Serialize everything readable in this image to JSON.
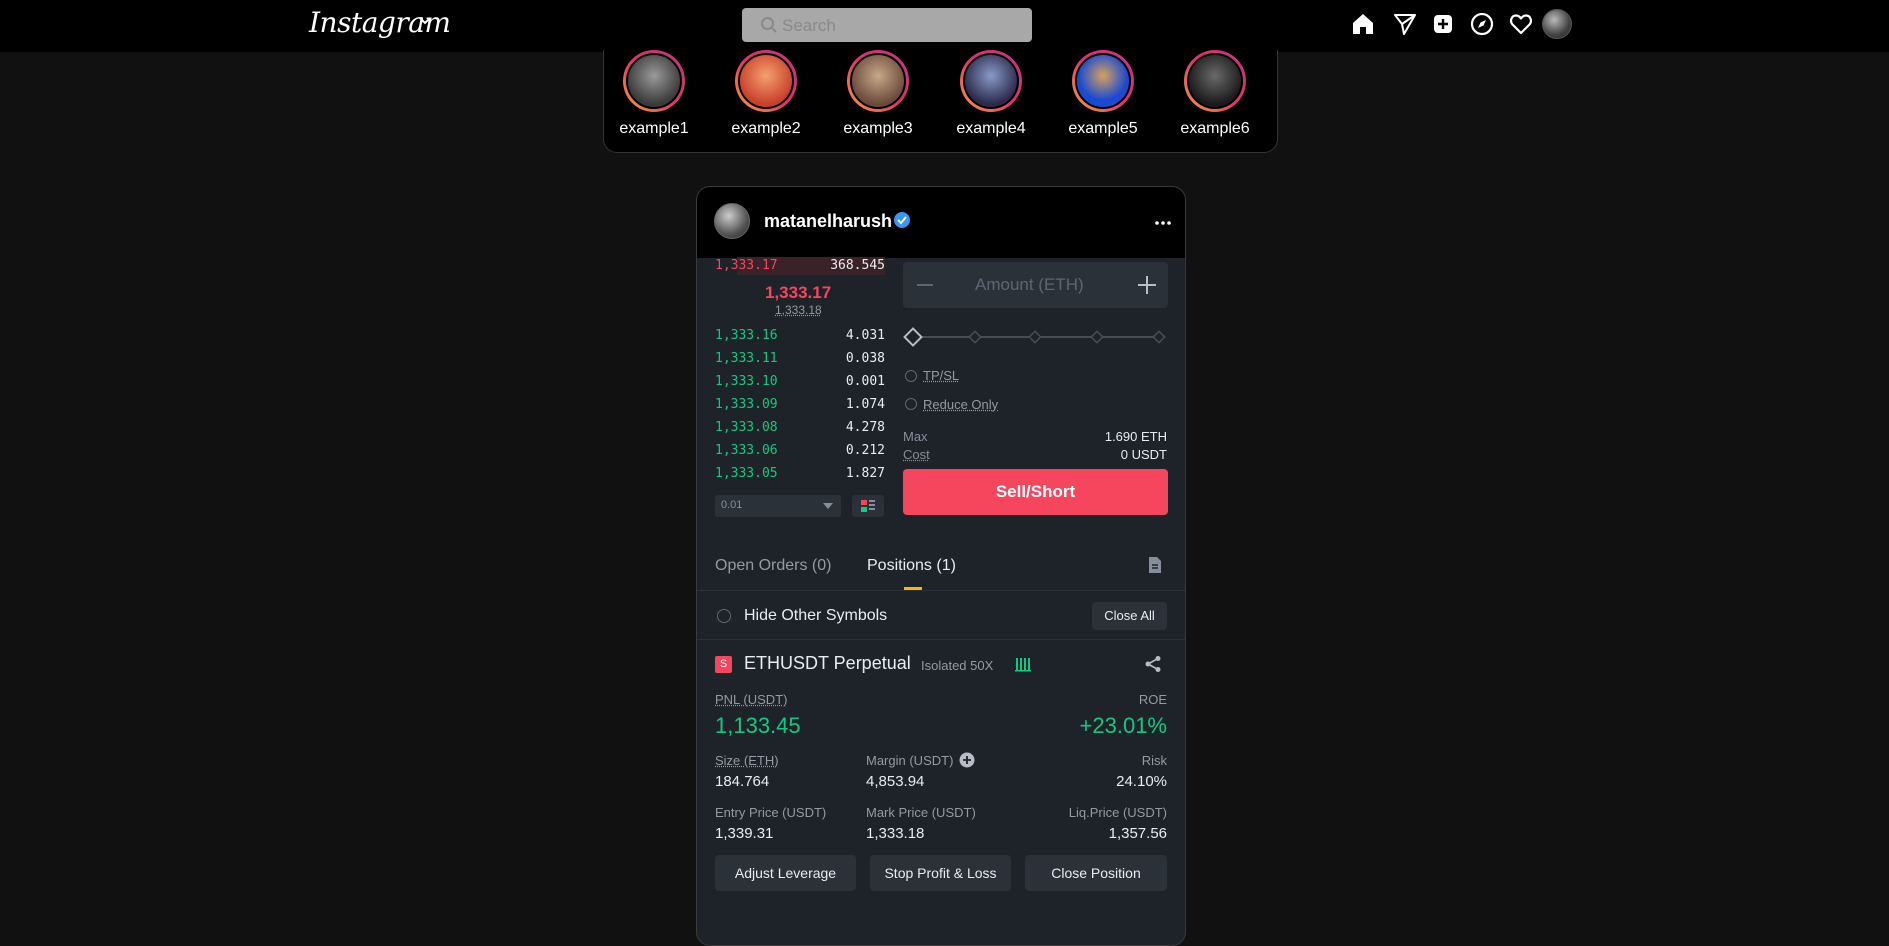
{
  "topnav": {
    "logo": "Instagram",
    "search_placeholder": "Search"
  },
  "stories": [
    {
      "name": "example1",
      "color": "#6b6b6b"
    },
    {
      "name": "example2",
      "color": "#e8603a"
    },
    {
      "name": "example3",
      "color": "#9a7a5a"
    },
    {
      "name": "example4",
      "color": "#3a4a7a"
    },
    {
      "name": "example5",
      "color": "#2a5ad0"
    },
    {
      "name": "example6",
      "color": "#3a3a3a"
    }
  ],
  "post": {
    "username": "matanelharush",
    "orderbook": {
      "ask": {
        "price": "1,333.17",
        "qty": "368.545"
      },
      "mid_price": "1,333.17",
      "mark_price": "1,333.18",
      "bids": [
        {
          "price": "1,333.16",
          "qty": "4.031"
        },
        {
          "price": "1,333.11",
          "qty": "0.038"
        },
        {
          "price": "1,333.10",
          "qty": "0.001"
        },
        {
          "price": "1,333.09",
          "qty": "1.074"
        },
        {
          "price": "1,333.08",
          "qty": "4.278"
        },
        {
          "price": "1,333.06",
          "qty": "0.212"
        },
        {
          "price": "1,333.05",
          "qty": "1.827"
        }
      ],
      "tick_select": "0.01"
    },
    "form": {
      "amount_placeholder": "Amount (ETH)",
      "tpsl_label": "TP/SL",
      "reduce_only_label": "Reduce Only",
      "max_label": "Max",
      "max_value": "1.690 ETH",
      "cost_label": "Cost",
      "cost_value": "0 USDT",
      "sell_button": "Sell/Short"
    },
    "tabs": {
      "open_orders": "Open Orders (0)",
      "positions": "Positions (1)"
    },
    "hide_other_symbols": "Hide Other Symbols",
    "close_all": "Close All",
    "position": {
      "side_badge": "S",
      "symbol": "ETHUSDT Perpetual",
      "margin_mode": "Isolated 50X",
      "pnl_label": "PNL (USDT)",
      "pnl_value": "1,133.45",
      "roe_label": "ROE",
      "roe_value": "+23.01%",
      "size_label": "Size (ETH)",
      "size_value": "184.764",
      "margin_label": "Margin (USDT)",
      "margin_value": "4,853.94",
      "risk_label": "Risk",
      "risk_value": "24.10%",
      "entry_label": "Entry Price (USDT)",
      "entry_value": "1,339.31",
      "mark_label": "Mark Price (USDT)",
      "mark_value": "1,333.18",
      "liq_label": "Liq.Price (USDT)",
      "liq_value": "1,357.56"
    },
    "actions": {
      "adjust_leverage": "Adjust Leverage",
      "stop_profit_loss": "Stop Profit & Loss",
      "close_position": "Close Position"
    }
  }
}
